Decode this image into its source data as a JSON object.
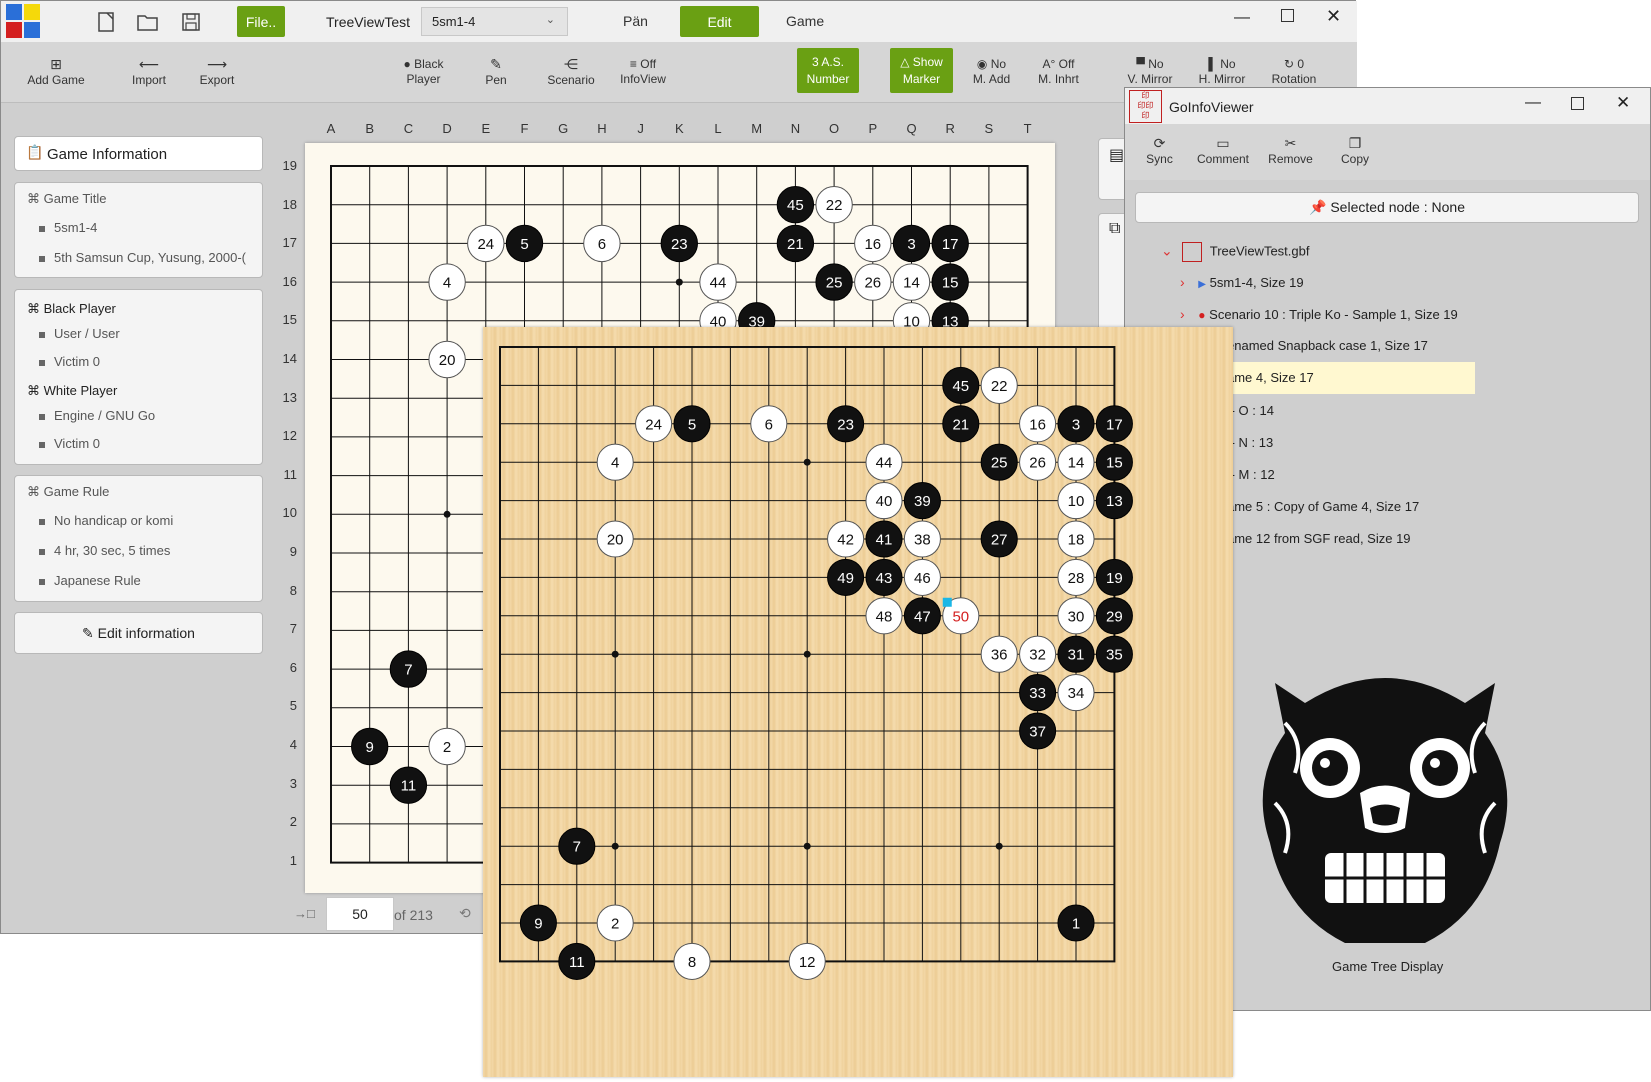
{
  "main": {
    "title": "TreeViewTest",
    "combo_value": "5sm1-4",
    "file_btn": "File..",
    "menu": [
      "Pän",
      "Edit",
      "Game"
    ],
    "toolbar": [
      {
        "icon": "add-game-icon",
        "glyph": "⊞",
        "label": "Add Game"
      },
      {
        "icon": "import-icon",
        "glyph": "⟵",
        "label": "Import"
      },
      {
        "icon": "export-icon",
        "glyph": "⟶",
        "label": "Export"
      },
      {
        "icon": "black-stone-icon",
        "glyph": "●",
        "label1": "Black",
        "label2": "Player"
      },
      {
        "icon": "pen-icon",
        "glyph": "✎",
        "label": "Pen"
      },
      {
        "icon": "scenario-icon",
        "glyph": "⋲",
        "label": "Scenario"
      },
      {
        "icon": "infoview-icon",
        "glyph": "≡",
        "label1": "Off",
        "label2": "InfoView"
      },
      {
        "label1": "3 A.S.",
        "label2": "Number"
      },
      {
        "label1": "△ Show",
        "label2": "Marker"
      },
      {
        "icon": "radio-icon",
        "glyph": "◉",
        "label1": "No",
        "label2": "M. Add"
      },
      {
        "icon": "inherit-icon",
        "glyph": "A°",
        "label1": "Off",
        "label2": "M. Inhrt"
      },
      {
        "icon": "v-mirror-icon",
        "glyph": "▀",
        "label1": "No",
        "label2": "V. Mirror"
      },
      {
        "icon": "h-mirror-icon",
        "glyph": "▌",
        "label1": "No",
        "label2": "H. Mirror"
      },
      {
        "icon": "rotation-icon",
        "glyph": "↻",
        "label1": "0",
        "label2": "Rotation"
      }
    ]
  },
  "info": {
    "header": "Game Information",
    "game_title_h": "Game Title",
    "game_title_items": [
      "5sm1-4",
      "5th Samsun Cup, Yusung, 2000-("
    ],
    "black_h": "Black Player",
    "black_items": [
      "User / User",
      "Victim 0"
    ],
    "white_h": "White Player",
    "white_items": [
      "Engine / GNU Go",
      "Victim 0"
    ],
    "rule_h": "Game Rule",
    "rule_items": [
      "No handicap or komi",
      "4 hr, 30 sec, 5 times",
      "Japanese Rule"
    ],
    "edit_btn": "Edit information"
  },
  "nav": {
    "move": "50",
    "of": "of 213"
  },
  "columns": [
    "A",
    "B",
    "C",
    "D",
    "E",
    "F",
    "G",
    "H",
    "J",
    "K",
    "L",
    "M",
    "N",
    "O",
    "P",
    "Q",
    "R",
    "S",
    "T"
  ],
  "rows": [
    "19",
    "18",
    "17",
    "16",
    "15",
    "14",
    "13",
    "12",
    "11",
    "10",
    "9",
    "8",
    "7",
    "6",
    "5",
    "4",
    "3",
    "2",
    "1"
  ],
  "stones19": [
    {
      "c": "N",
      "r": 18,
      "col": "b",
      "n": "45"
    },
    {
      "c": "O",
      "r": 18,
      "col": "w",
      "n": "22"
    },
    {
      "c": "E",
      "r": 17,
      "col": "w",
      "n": "24"
    },
    {
      "c": "F",
      "r": 17,
      "col": "b",
      "n": "5"
    },
    {
      "c": "H",
      "r": 17,
      "col": "w",
      "n": "6"
    },
    {
      "c": "K",
      "r": 17,
      "col": "b",
      "n": "23"
    },
    {
      "c": "N",
      "r": 17,
      "col": "b",
      "n": "21"
    },
    {
      "c": "P",
      "r": 17,
      "col": "w",
      "n": "16"
    },
    {
      "c": "Q",
      "r": 17,
      "col": "b",
      "n": "3"
    },
    {
      "c": "R",
      "r": 17,
      "col": "b",
      "n": "17"
    },
    {
      "c": "D",
      "r": 16,
      "col": "w",
      "n": "4"
    },
    {
      "c": "L",
      "r": 16,
      "col": "w",
      "n": "44"
    },
    {
      "c": "O",
      "r": 16,
      "col": "b",
      "n": "25"
    },
    {
      "c": "P",
      "r": 16,
      "col": "w",
      "n": "26"
    },
    {
      "c": "Q",
      "r": 16,
      "col": "w",
      "n": "14"
    },
    {
      "c": "R",
      "r": 16,
      "col": "b",
      "n": "15"
    },
    {
      "c": "L",
      "r": 15,
      "col": "w",
      "n": "40"
    },
    {
      "c": "M",
      "r": 15,
      "col": "b",
      "n": "39"
    },
    {
      "c": "Q",
      "r": 15,
      "col": "w",
      "n": "10"
    },
    {
      "c": "R",
      "r": 15,
      "col": "b",
      "n": "13"
    },
    {
      "c": "D",
      "r": 14,
      "col": "w",
      "n": "20"
    },
    {
      "c": "C",
      "r": 6,
      "col": "b",
      "n": "7"
    },
    {
      "c": "B",
      "r": 4,
      "col": "b",
      "n": "9"
    },
    {
      "c": "D",
      "r": 4,
      "col": "w",
      "n": "2"
    },
    {
      "c": "C",
      "r": 3,
      "col": "b",
      "n": "11"
    }
  ],
  "stones17": [
    {
      "x": 12,
      "y": 1,
      "col": "b",
      "n": "45"
    },
    {
      "x": 13,
      "y": 1,
      "col": "w",
      "n": "22"
    },
    {
      "x": 4,
      "y": 2,
      "col": "w",
      "n": "24"
    },
    {
      "x": 5,
      "y": 2,
      "col": "b",
      "n": "5"
    },
    {
      "x": 7,
      "y": 2,
      "col": "w",
      "n": "6"
    },
    {
      "x": 9,
      "y": 2,
      "col": "b",
      "n": "23"
    },
    {
      "x": 12,
      "y": 2,
      "col": "b",
      "n": "21"
    },
    {
      "x": 14,
      "y": 2,
      "col": "w",
      "n": "16"
    },
    {
      "x": 15,
      "y": 2,
      "col": "b",
      "n": "3"
    },
    {
      "x": 16,
      "y": 2,
      "col": "b",
      "n": "17"
    },
    {
      "x": 3,
      "y": 3,
      "col": "w",
      "n": "4"
    },
    {
      "x": 10,
      "y": 3,
      "col": "w",
      "n": "44"
    },
    {
      "x": 13,
      "y": 3,
      "col": "b",
      "n": "25"
    },
    {
      "x": 14,
      "y": 3,
      "col": "w",
      "n": "26"
    },
    {
      "x": 15,
      "y": 3,
      "col": "w",
      "n": "14"
    },
    {
      "x": 16,
      "y": 3,
      "col": "b",
      "n": "15"
    },
    {
      "x": 10,
      "y": 4,
      "col": "w",
      "n": "40"
    },
    {
      "x": 11,
      "y": 4,
      "col": "b",
      "n": "39"
    },
    {
      "x": 15,
      "y": 4,
      "col": "w",
      "n": "10"
    },
    {
      "x": 16,
      "y": 4,
      "col": "b",
      "n": "13"
    },
    {
      "x": 3,
      "y": 5,
      "col": "w",
      "n": "20"
    },
    {
      "x": 9,
      "y": 5,
      "col": "w",
      "n": "42"
    },
    {
      "x": 10,
      "y": 5,
      "col": "b",
      "n": "41"
    },
    {
      "x": 11,
      "y": 5,
      "col": "w",
      "n": "38"
    },
    {
      "x": 13,
      "y": 5,
      "col": "b",
      "n": "27"
    },
    {
      "x": 15,
      "y": 5,
      "col": "w",
      "n": "18"
    },
    {
      "x": 9,
      "y": 6,
      "col": "b",
      "n": "49"
    },
    {
      "x": 10,
      "y": 6,
      "col": "b",
      "n": "43"
    },
    {
      "x": 11,
      "y": 6,
      "col": "w",
      "n": "46"
    },
    {
      "x": 15,
      "y": 6,
      "col": "w",
      "n": "28"
    },
    {
      "x": 16,
      "y": 6,
      "col": "b",
      "n": "19"
    },
    {
      "x": 10,
      "y": 7,
      "col": "w",
      "n": "48"
    },
    {
      "x": 11,
      "y": 7,
      "col": "b",
      "n": "47"
    },
    {
      "x": 12,
      "y": 7,
      "col": "w",
      "n": "50",
      "last": true
    },
    {
      "x": 15,
      "y": 7,
      "col": "w",
      "n": "30"
    },
    {
      "x": 16,
      "y": 7,
      "col": "b",
      "n": "29"
    },
    {
      "x": 13,
      "y": 8,
      "col": "w",
      "n": "36"
    },
    {
      "x": 14,
      "y": 8,
      "col": "w",
      "n": "32"
    },
    {
      "x": 15,
      "y": 8,
      "col": "b",
      "n": "31"
    },
    {
      "x": 16,
      "y": 8,
      "col": "b",
      "n": "35"
    },
    {
      "x": 14,
      "y": 9,
      "col": "b",
      "n": "33"
    },
    {
      "x": 15,
      "y": 9,
      "col": "w",
      "n": "34"
    },
    {
      "x": 14,
      "y": 10,
      "col": "b",
      "n": "37"
    },
    {
      "x": 2,
      "y": 13,
      "col": "b",
      "n": "7"
    },
    {
      "x": 1,
      "y": 15,
      "col": "b",
      "n": "9"
    },
    {
      "x": 3,
      "y": 15,
      "col": "w",
      "n": "2"
    },
    {
      "x": 15,
      "y": 15,
      "col": "b",
      "n": "1"
    },
    {
      "x": 2,
      "y": 16,
      "col": "b",
      "n": "11"
    },
    {
      "x": 5,
      "y": 16,
      "col": "w",
      "n": "8"
    },
    {
      "x": 8,
      "y": 16,
      "col": "w",
      "n": "12"
    }
  ],
  "viewer": {
    "title": "GoInfoViewer",
    "tools": [
      {
        "icon": "sync-icon",
        "glyph": "⟳",
        "label": "Sync"
      },
      {
        "icon": "comment-icon",
        "glyph": "▭",
        "label": "Comment"
      },
      {
        "icon": "remove-icon",
        "glyph": "✂",
        "label": "Remove"
      },
      {
        "icon": "copy-icon",
        "glyph": "❐",
        "label": "Copy"
      }
    ],
    "selected": "Selected node : None",
    "root": "TreeViewTest.gbf",
    "nodes": [
      "5sm1-4, Size 19",
      "Scenario 10 : Triple Ko - Sample 1, Size 19",
      "enamed Snapback case 1, Size 17",
      "ame 4, Size 17",
      ":- O : 14",
      ":- N : 13",
      ":- M : 12",
      "ame 5 : Copy of Game 4, Size 17",
      "ame 12 from SGF read, Size 19"
    ],
    "caption": "Game Tree Display"
  },
  "colors": {
    "accent": "#6aa013",
    "last_move": "#d42020",
    "highlight": "#fff8d0"
  }
}
